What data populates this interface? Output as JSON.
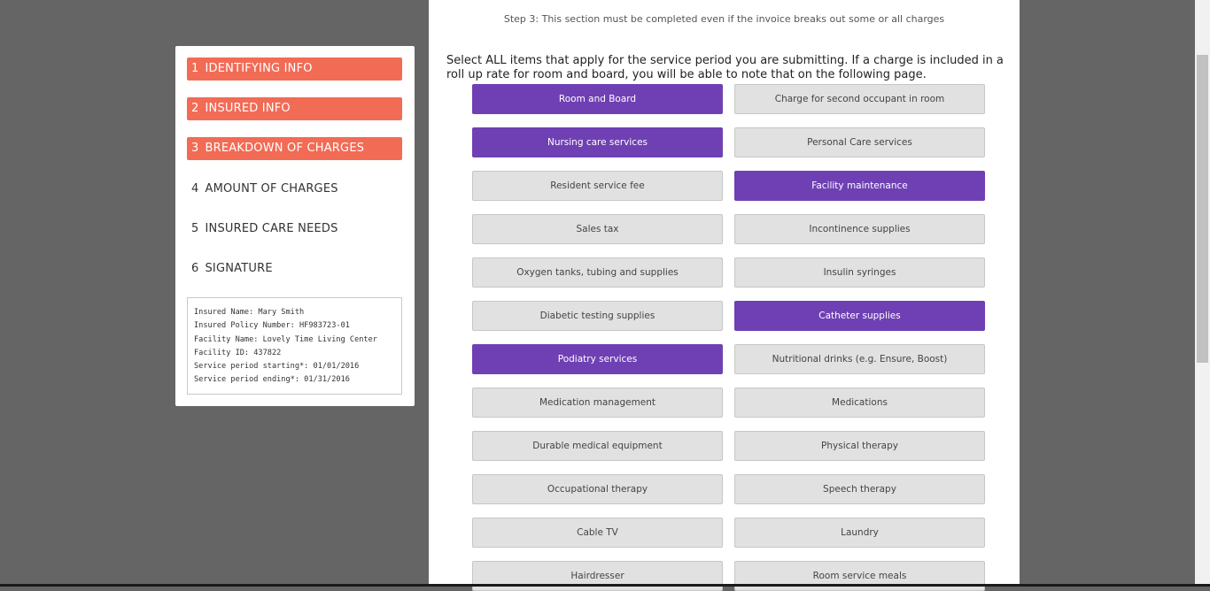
{
  "sidebar": {
    "steps": [
      {
        "num": "1",
        "label": "IDENTIFYING INFO",
        "state": "done"
      },
      {
        "num": "2",
        "label": "INSURED INFO",
        "state": "done"
      },
      {
        "num": "3",
        "label": "BREAKDOWN OF CHARGES",
        "state": "done"
      },
      {
        "num": "4",
        "label": "AMOUNT OF CHARGES",
        "state": "pending"
      },
      {
        "num": "5",
        "label": "INSURED CARE NEEDS",
        "state": "pending"
      },
      {
        "num": "6",
        "label": "SIGNATURE",
        "state": "pending"
      }
    ],
    "info": [
      "Insured Name: Mary Smith",
      "Insured Policy Number: HF983723-01",
      "Facility Name: Lovely Time Living Center",
      "Facility ID: 437822",
      "Service period starting*: 01/01/2016",
      "Service period ending*: 01/31/2016"
    ]
  },
  "main": {
    "step_note": "Step 3: This section must be completed even if the invoice breaks out some or all charges",
    "instructions": "Select ALL items that apply for the service period you are submitting. If a charge is included in a roll up rate for room and board, you will be able to note that on the following page.",
    "options": [
      {
        "label": "Room and Board",
        "selected": true
      },
      {
        "label": "Charge for second occupant in room",
        "selected": false
      },
      {
        "label": "Nursing care services",
        "selected": true
      },
      {
        "label": "Personal Care services",
        "selected": false
      },
      {
        "label": "Resident service fee",
        "selected": false
      },
      {
        "label": "Facility maintenance",
        "selected": true
      },
      {
        "label": "Sales tax",
        "selected": false
      },
      {
        "label": "Incontinence supplies",
        "selected": false
      },
      {
        "label": "Oxygen tanks, tubing and supplies",
        "selected": false
      },
      {
        "label": "Insulin syringes",
        "selected": false
      },
      {
        "label": "Diabetic testing supplies",
        "selected": false
      },
      {
        "label": "Catheter supplies",
        "selected": true
      },
      {
        "label": "Podiatry services",
        "selected": true
      },
      {
        "label": "Nutritional drinks (e.g. Ensure, Boost)",
        "selected": false
      },
      {
        "label": "Medication management",
        "selected": false
      },
      {
        "label": "Medications",
        "selected": false
      },
      {
        "label": "Durable medical equipment",
        "selected": false
      },
      {
        "label": "Physical therapy",
        "selected": false
      },
      {
        "label": "Occupational therapy",
        "selected": false
      },
      {
        "label": "Speech therapy",
        "selected": false
      },
      {
        "label": "Cable TV",
        "selected": false
      },
      {
        "label": "Laundry",
        "selected": false
      },
      {
        "label": "Hairdresser",
        "selected": false
      },
      {
        "label": "Room service meals",
        "selected": false
      }
    ]
  },
  "colors": {
    "step_done": "#f26b55",
    "option_selected": "#6f40b3",
    "option_default": "#e1e1e1",
    "backdrop": "#656565"
  }
}
